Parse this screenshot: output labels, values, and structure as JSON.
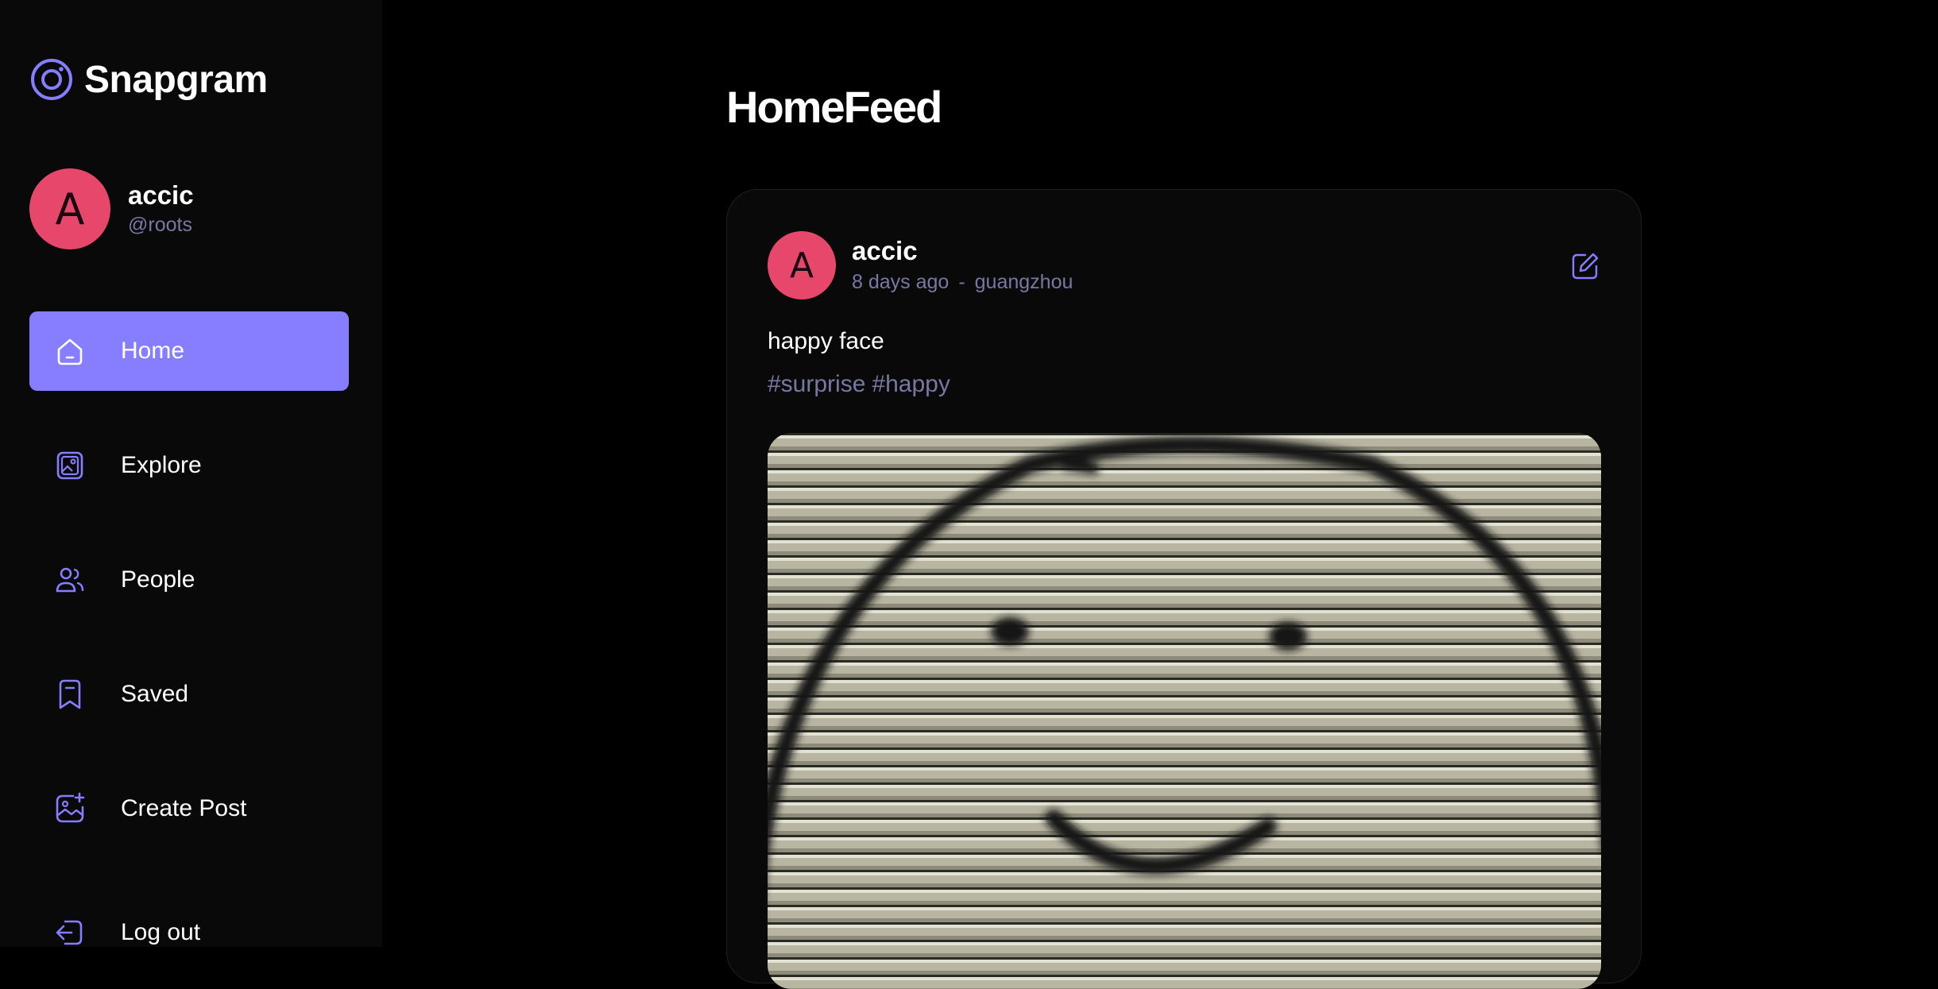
{
  "app": {
    "name": "Snapgram"
  },
  "colors": {
    "accent": "#877EFF",
    "avatar": "#E8476C",
    "muted": "#7878A3",
    "sidebar": "#09090A",
    "background": "#000000"
  },
  "user": {
    "initial": "A",
    "name": "accic",
    "handle": "@roots"
  },
  "nav": {
    "items": [
      {
        "label": "Home",
        "icon": "home-icon",
        "active": true
      },
      {
        "label": "Explore",
        "icon": "gallery-icon"
      },
      {
        "label": "People",
        "icon": "people-icon"
      },
      {
        "label": "Saved",
        "icon": "bookmark-icon"
      },
      {
        "label": "Create Post",
        "icon": "add-image-icon"
      }
    ],
    "logout": {
      "label": "Log out",
      "icon": "logout-icon"
    }
  },
  "main": {
    "title": "HomeFeed"
  },
  "post": {
    "author_initial": "A",
    "author": "accic",
    "time": "8 days ago",
    "separator": "-",
    "location": "guangzhou",
    "caption": "happy face",
    "tags": [
      "#surprise",
      "#happy"
    ],
    "image_subject": "smiley face spray-painted on a roller shutter"
  }
}
